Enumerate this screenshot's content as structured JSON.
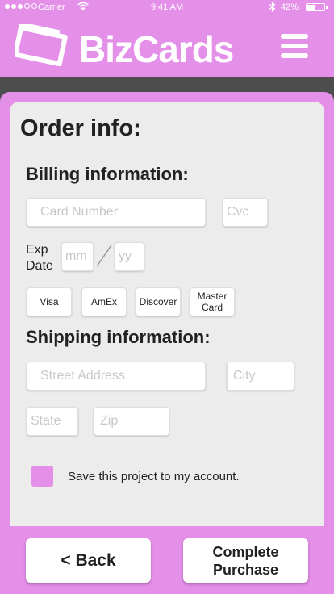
{
  "status_bar": {
    "carrier": "Carrier",
    "time": "9:41 AM",
    "battery": "42%",
    "battery_level": 0.42
  },
  "header": {
    "brand": "BizCards",
    "logo_icon": "card-stack-icon",
    "menu_icon": "hamburger-icon"
  },
  "order": {
    "title": "Order info:",
    "billing": {
      "heading": "Billing information:",
      "card_number_placeholder": "Card Number",
      "cvc_placeholder": "Cvc",
      "exp_label_line1": "Exp",
      "exp_label_line2": "Date",
      "mm_placeholder": "mm",
      "yy_placeholder": "yy",
      "card_types": [
        "Visa",
        "AmEx",
        "Discover",
        "Master Card"
      ]
    },
    "shipping": {
      "heading": "Shipping information:",
      "street_placeholder": "Street Address",
      "city_placeholder": "City",
      "state_placeholder": "State",
      "zip_placeholder": "Zip"
    },
    "save_label": "Save this project to my account."
  },
  "footer": {
    "back_label": "< Back",
    "complete_label": "Complete Purchase"
  },
  "colors": {
    "accent": "#e48fe8",
    "panel": "#ececec",
    "dark_band": "#4d4d4d"
  }
}
